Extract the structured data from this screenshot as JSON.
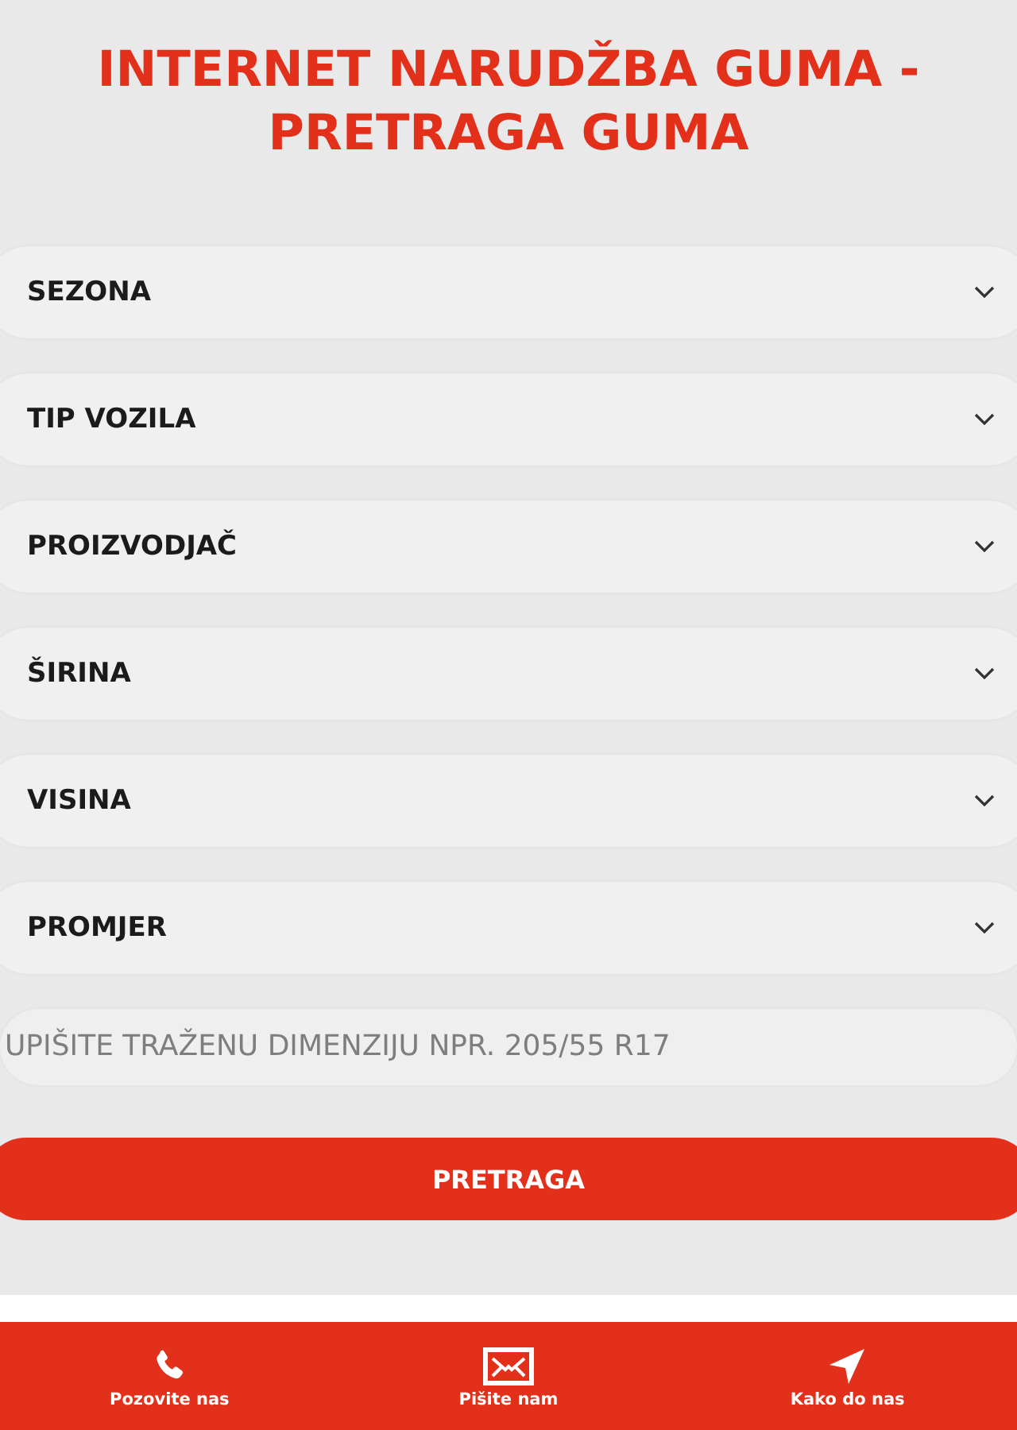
{
  "title": "INTERNET NARUDŽBA GUMA - PRETRAGA GUMA",
  "filters": [
    {
      "label": "SEZONA"
    },
    {
      "label": "TIP VOZILA"
    },
    {
      "label": "PROIZVODJAČ"
    },
    {
      "label": "ŠIRINA"
    },
    {
      "label": "VISINA"
    },
    {
      "label": "PROMJER"
    }
  ],
  "dimension_field": {
    "placeholder": "UPIŠITE TRAŽENU DIMENZIJU NPR. 205/55 R17"
  },
  "search_button": {
    "label": "PRETRAGA"
  },
  "bottom_bar": {
    "items": [
      {
        "kind": "phone",
        "label": "Pozovite nas"
      },
      {
        "kind": "mail",
        "label": "Pišite nam"
      },
      {
        "kind": "location",
        "label": "Kako do nas"
      }
    ]
  }
}
